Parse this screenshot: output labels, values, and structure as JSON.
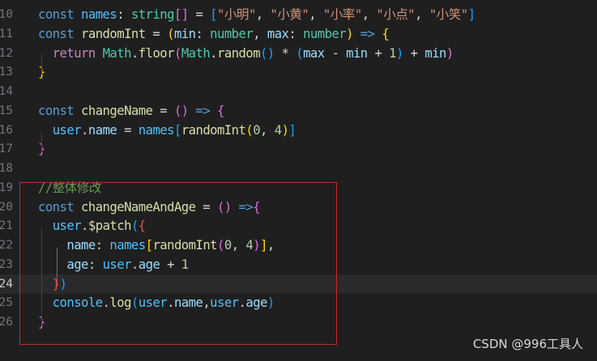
{
  "editor": {
    "theme": {
      "background": "#1f1f1f",
      "current_line": "#2a2a2a",
      "highlight_border": "#c42b2b"
    },
    "active_line": "24",
    "highlighted_region": [
      "19",
      "26"
    ],
    "lines": [
      {
        "number": "10",
        "tokens": [
          {
            "t": "const",
            "c": "#569cd6"
          },
          {
            "t": " "
          },
          {
            "t": "names",
            "c": "#4fc1ff"
          },
          {
            "t": ": "
          },
          {
            "t": "string",
            "c": "#4ec9b0"
          },
          {
            "t": "[]",
            "c": "#da70d6"
          },
          {
            "t": " = "
          },
          {
            "t": "[",
            "c": "#179fff"
          },
          {
            "t": "\"小明\"",
            "c": "#ce9178"
          },
          {
            "t": ", "
          },
          {
            "t": "\"小黄\"",
            "c": "#ce9178"
          },
          {
            "t": ", "
          },
          {
            "t": "\"小率\"",
            "c": "#ce9178"
          },
          {
            "t": ", "
          },
          {
            "t": "\"小点\"",
            "c": "#ce9178"
          },
          {
            "t": ", "
          },
          {
            "t": "\"小笑\"",
            "c": "#ce9178"
          },
          {
            "t": "]",
            "c": "#179fff"
          }
        ]
      },
      {
        "number": "11",
        "tokens": [
          {
            "t": "const",
            "c": "#569cd6"
          },
          {
            "t": " "
          },
          {
            "t": "randomInt",
            "c": "#dcdcaa"
          },
          {
            "t": " = "
          },
          {
            "t": "(",
            "c": "#ffd700"
          },
          {
            "t": "min",
            "c": "#9cdcfe"
          },
          {
            "t": ": "
          },
          {
            "t": "number",
            "c": "#4ec9b0"
          },
          {
            "t": ", "
          },
          {
            "t": "max",
            "c": "#9cdcfe"
          },
          {
            "t": ": "
          },
          {
            "t": "number",
            "c": "#4ec9b0"
          },
          {
            "t": ")",
            "c": "#ffd700"
          },
          {
            "t": " "
          },
          {
            "t": "=>",
            "c": "#569cd6"
          },
          {
            "t": " "
          },
          {
            "t": "{",
            "c": "#ffd700"
          }
        ]
      },
      {
        "number": "12",
        "tokens": [
          {
            "t": "  "
          },
          {
            "t": "return",
            "c": "#c586c0"
          },
          {
            "t": " "
          },
          {
            "t": "Math",
            "c": "#4ec9b0"
          },
          {
            "t": "."
          },
          {
            "t": "floor",
            "c": "#dcdcaa"
          },
          {
            "t": "(",
            "c": "#da70d6"
          },
          {
            "t": "Math",
            "c": "#4ec9b0"
          },
          {
            "t": "."
          },
          {
            "t": "random",
            "c": "#dcdcaa"
          },
          {
            "t": "()",
            "c": "#179fff"
          },
          {
            "t": " * "
          },
          {
            "t": "(",
            "c": "#179fff"
          },
          {
            "t": "max",
            "c": "#9cdcfe"
          },
          {
            "t": " - "
          },
          {
            "t": "min",
            "c": "#9cdcfe"
          },
          {
            "t": " + "
          },
          {
            "t": "1",
            "c": "#b5cea8"
          },
          {
            "t": ")",
            "c": "#179fff"
          },
          {
            "t": " + "
          },
          {
            "t": "min",
            "c": "#9cdcfe"
          },
          {
            "t": ")",
            "c": "#da70d6"
          }
        ]
      },
      {
        "number": "13",
        "tokens": [
          {
            "t": "}",
            "c": "#ffd700"
          }
        ]
      },
      {
        "number": "14",
        "tokens": []
      },
      {
        "number": "15",
        "tokens": [
          {
            "t": "const",
            "c": "#569cd6"
          },
          {
            "t": " "
          },
          {
            "t": "changeName",
            "c": "#dcdcaa"
          },
          {
            "t": " = "
          },
          {
            "t": "()",
            "c": "#da70d6"
          },
          {
            "t": " "
          },
          {
            "t": "=>",
            "c": "#569cd6"
          },
          {
            "t": " "
          },
          {
            "t": "{",
            "c": "#da70d6"
          }
        ]
      },
      {
        "number": "16",
        "tokens": [
          {
            "t": "  "
          },
          {
            "t": "user",
            "c": "#4fc1ff"
          },
          {
            "t": "."
          },
          {
            "t": "name",
            "c": "#9cdcfe"
          },
          {
            "t": " = "
          },
          {
            "t": "names",
            "c": "#4fc1ff"
          },
          {
            "t": "[",
            "c": "#179fff"
          },
          {
            "t": "randomInt",
            "c": "#dcdcaa"
          },
          {
            "t": "(",
            "c": "#ffd700"
          },
          {
            "t": "0",
            "c": "#b5cea8"
          },
          {
            "t": ", "
          },
          {
            "t": "4",
            "c": "#b5cea8"
          },
          {
            "t": ")",
            "c": "#ffd700"
          },
          {
            "t": "]",
            "c": "#179fff"
          }
        ]
      },
      {
        "number": "17",
        "tokens": [
          {
            "t": "}",
            "c": "#da70d6"
          }
        ]
      },
      {
        "number": "18",
        "tokens": []
      },
      {
        "number": "19",
        "tokens": [
          {
            "t": "//整体修改",
            "c": "#6a9955"
          }
        ]
      },
      {
        "number": "20",
        "tokens": [
          {
            "t": "const",
            "c": "#569cd6"
          },
          {
            "t": " "
          },
          {
            "t": "changeNameAndAge",
            "c": "#dcdcaa"
          },
          {
            "t": " = "
          },
          {
            "t": "()",
            "c": "#da70d6"
          },
          {
            "t": " "
          },
          {
            "t": "=>",
            "c": "#569cd6"
          },
          {
            "t": "{",
            "c": "#da70d6"
          }
        ]
      },
      {
        "number": "21",
        "tokens": [
          {
            "t": "  "
          },
          {
            "t": "user",
            "c": "#4fc1ff"
          },
          {
            "t": "."
          },
          {
            "t": "$patch",
            "c": "#dcdcaa"
          },
          {
            "t": "(",
            "c": "#179fff"
          },
          {
            "t": "{",
            "c": "#f44747"
          }
        ]
      },
      {
        "number": "22",
        "tokens": [
          {
            "t": "    "
          },
          {
            "t": "name",
            "c": "#9cdcfe"
          },
          {
            "t": ": "
          },
          {
            "t": "names",
            "c": "#4fc1ff"
          },
          {
            "t": "[",
            "c": "#ffd700"
          },
          {
            "t": "randomInt",
            "c": "#dcdcaa"
          },
          {
            "t": "(",
            "c": "#da70d6"
          },
          {
            "t": "0",
            "c": "#b5cea8"
          },
          {
            "t": ", "
          },
          {
            "t": "4",
            "c": "#b5cea8"
          },
          {
            "t": ")",
            "c": "#da70d6"
          },
          {
            "t": "]",
            "c": "#ffd700"
          },
          {
            "t": ","
          }
        ]
      },
      {
        "number": "23",
        "tokens": [
          {
            "t": "    "
          },
          {
            "t": "age",
            "c": "#9cdcfe"
          },
          {
            "t": ": "
          },
          {
            "t": "user",
            "c": "#4fc1ff"
          },
          {
            "t": "."
          },
          {
            "t": "age",
            "c": "#9cdcfe"
          },
          {
            "t": " + "
          },
          {
            "t": "1",
            "c": "#b5cea8"
          }
        ]
      },
      {
        "number": "24",
        "tokens": [
          {
            "t": "  "
          },
          {
            "t": "}",
            "c": "#f44747"
          },
          {
            "t": ")",
            "c": "#179fff"
          }
        ]
      },
      {
        "number": "25",
        "tokens": [
          {
            "t": "  "
          },
          {
            "t": "console",
            "c": "#4fc1ff"
          },
          {
            "t": "."
          },
          {
            "t": "log",
            "c": "#dcdcaa"
          },
          {
            "t": "(",
            "c": "#179fff"
          },
          {
            "t": "user",
            "c": "#4fc1ff"
          },
          {
            "t": "."
          },
          {
            "t": "name",
            "c": "#9cdcfe"
          },
          {
            "t": ","
          },
          {
            "t": "user",
            "c": "#4fc1ff"
          },
          {
            "t": "."
          },
          {
            "t": "age",
            "c": "#9cdcfe"
          },
          {
            "t": ")",
            "c": "#179fff"
          }
        ]
      },
      {
        "number": "26",
        "tokens": [
          {
            "t": "}",
            "c": "#da70d6"
          }
        ]
      }
    ]
  },
  "watermark": "CSDN @996工具人"
}
